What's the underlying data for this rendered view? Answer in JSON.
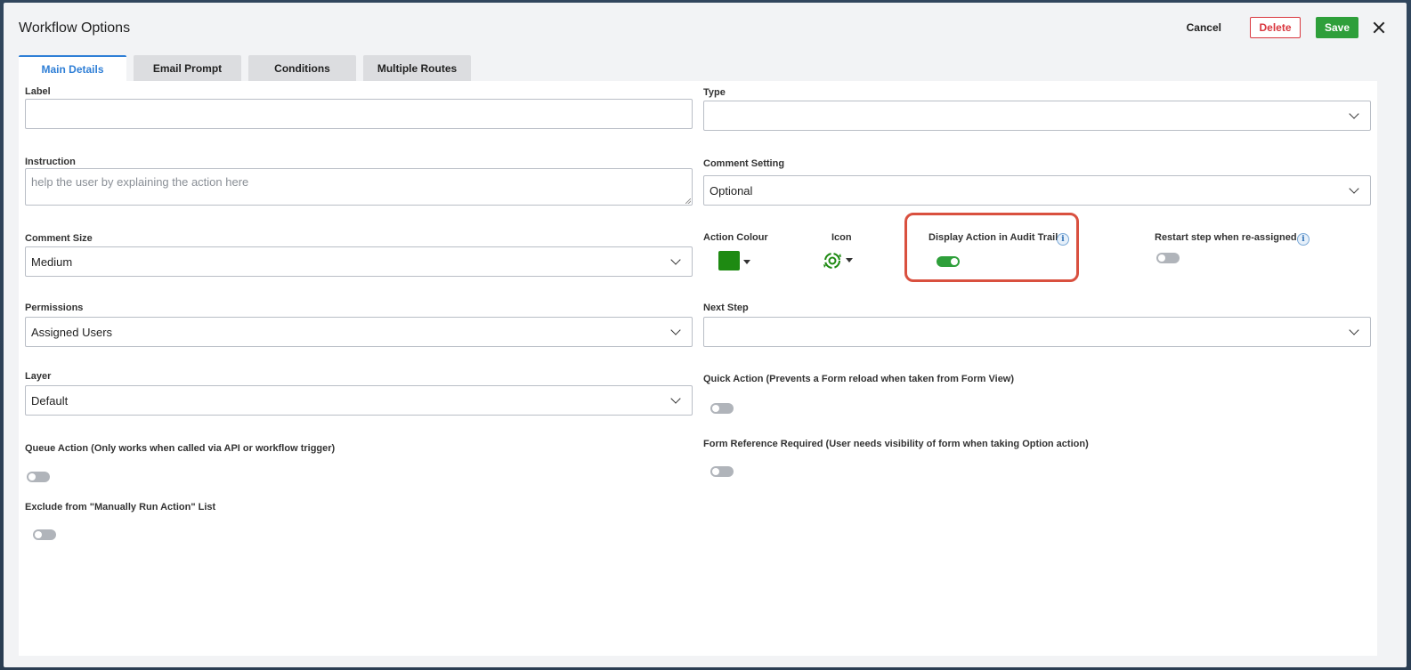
{
  "dialog": {
    "title": "Workflow Options",
    "actions": {
      "cancel": "Cancel",
      "delete": "Delete",
      "save": "Save"
    }
  },
  "tabs": [
    {
      "label": "Main Details",
      "active": true
    },
    {
      "label": "Email Prompt",
      "active": false
    },
    {
      "label": "Conditions",
      "active": false
    },
    {
      "label": "Multiple Routes",
      "active": false
    }
  ],
  "form": {
    "label": {
      "label": "Label",
      "value": ""
    },
    "type": {
      "label": "Type",
      "value": ""
    },
    "instruction": {
      "label": "Instruction",
      "placeholder": "help the user by explaining the action here"
    },
    "comment_setting": {
      "label": "Comment Setting",
      "value": "Optional"
    },
    "comment_size": {
      "label": "Comment Size",
      "value": "Medium"
    },
    "action_colour": {
      "label": "Action Colour",
      "color": "#1e8a12"
    },
    "icon": {
      "label": "Icon",
      "icon_name": "gear-cycle-icon"
    },
    "display_in_audit": {
      "label": "Display Action in Audit Trail",
      "on": true
    },
    "restart_step": {
      "label": "Restart step when re-assigned",
      "on": false
    },
    "permissions": {
      "label": "Permissions",
      "value": "Assigned Users"
    },
    "next_step": {
      "label": "Next Step",
      "value": ""
    },
    "layer": {
      "label": "Layer",
      "value": "Default"
    },
    "quick_action": {
      "label": "Quick Action (Prevents a Form reload when taken from Form View)",
      "on": false
    },
    "queue_action": {
      "label": "Queue Action (Only works when called via API or workflow trigger)",
      "on": false
    },
    "form_ref_required": {
      "label": "Form Reference Required (User needs visibility of form when taking Option action)",
      "on": false
    },
    "exclude_manual": {
      "label": "Exclude from \"Manually Run Action\" List",
      "on": false
    }
  },
  "info_glyph": "i",
  "colors": {
    "accent": "#2f7fd6",
    "save": "#2e9f3a",
    "delete": "#d9363e",
    "highlight": "#d9503f"
  }
}
